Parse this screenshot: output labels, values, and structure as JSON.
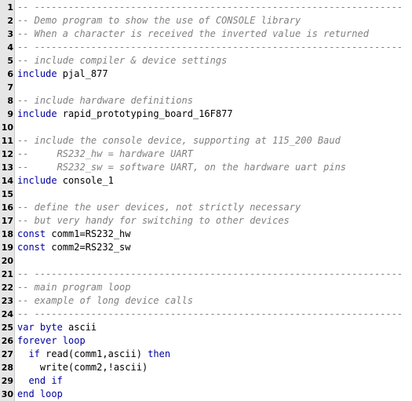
{
  "colors": {
    "comment": "#808080",
    "keyword": "#0000a0",
    "constant": "#008000",
    "text": "#000000",
    "gutter_bg": "#e6e6e6"
  },
  "lines": [
    {
      "n": "1",
      "tokens": [
        {
          "t": "-- -----------------------------------------------------------------",
          "k": "comment"
        }
      ]
    },
    {
      "n": "2",
      "tokens": [
        {
          "t": "-- Demo program to show the use of CONSOLE library",
          "k": "comment"
        }
      ]
    },
    {
      "n": "3",
      "tokens": [
        {
          "t": "-- When a character is received the inverted value is returned",
          "k": "comment"
        }
      ]
    },
    {
      "n": "4",
      "tokens": [
        {
          "t": "-- -----------------------------------------------------------------",
          "k": "comment"
        }
      ]
    },
    {
      "n": "5",
      "tokens": [
        {
          "t": "-- include compiler & device settings",
          "k": "comment"
        }
      ]
    },
    {
      "n": "6",
      "tokens": [
        {
          "t": "include",
          "k": "keyword"
        },
        {
          "t": " pjal_877",
          "k": "plain"
        }
      ]
    },
    {
      "n": "7",
      "tokens": []
    },
    {
      "n": "8",
      "tokens": [
        {
          "t": "-- include hardware definitions",
          "k": "comment"
        }
      ]
    },
    {
      "n": "9",
      "tokens": [
        {
          "t": "include",
          "k": "keyword"
        },
        {
          "t": " rapid_prototyping_board_16F877",
          "k": "plain"
        }
      ]
    },
    {
      "n": "10",
      "tokens": []
    },
    {
      "n": "11",
      "tokens": [
        {
          "t": "-- include the console device, supporting at 115_200 Baud",
          "k": "comment"
        }
      ]
    },
    {
      "n": "12",
      "tokens": [
        {
          "t": "--     RS232_hw = hardware UART",
          "k": "comment"
        }
      ]
    },
    {
      "n": "13",
      "tokens": [
        {
          "t": "--     RS232_sw = software UART, on the hardware uart pins",
          "k": "comment"
        }
      ]
    },
    {
      "n": "14",
      "tokens": [
        {
          "t": "include",
          "k": "keyword"
        },
        {
          "t": " console_1",
          "k": "plain"
        }
      ]
    },
    {
      "n": "15",
      "tokens": []
    },
    {
      "n": "16",
      "tokens": [
        {
          "t": "-- define the user devices, not strictly necessary",
          "k": "comment"
        }
      ]
    },
    {
      "n": "17",
      "tokens": [
        {
          "t": "-- but very handy for switching to other devices",
          "k": "comment"
        }
      ]
    },
    {
      "n": "18",
      "tokens": [
        {
          "t": "const",
          "k": "keyword"
        },
        {
          "t": " comm1=",
          "k": "plain"
        },
        {
          "t": "RS232_hw",
          "k": "constant"
        }
      ]
    },
    {
      "n": "19",
      "tokens": [
        {
          "t": "const",
          "k": "keyword"
        },
        {
          "t": " comm2=",
          "k": "plain"
        },
        {
          "t": "RS232_sw",
          "k": "constant"
        }
      ]
    },
    {
      "n": "20",
      "tokens": []
    },
    {
      "n": "21",
      "tokens": [
        {
          "t": "-- -----------------------------------------------------------------",
          "k": "comment"
        }
      ]
    },
    {
      "n": "22",
      "tokens": [
        {
          "t": "-- main program loop",
          "k": "comment"
        }
      ]
    },
    {
      "n": "23",
      "tokens": [
        {
          "t": "-- example of long device calls",
          "k": "comment"
        }
      ]
    },
    {
      "n": "24",
      "tokens": [
        {
          "t": "-- -----------------------------------------------------------------",
          "k": "comment"
        }
      ]
    },
    {
      "n": "25",
      "tokens": [
        {
          "t": "var byte",
          "k": "keyword"
        },
        {
          "t": " ascii",
          "k": "plain"
        }
      ]
    },
    {
      "n": "26",
      "tokens": [
        {
          "t": "forever loop",
          "k": "keyword"
        }
      ]
    },
    {
      "n": "27",
      "tokens": [
        {
          "t": "  ",
          "k": "plain"
        },
        {
          "t": "if",
          "k": "keyword"
        },
        {
          "t": " read(comm1,ascii) ",
          "k": "plain"
        },
        {
          "t": "then",
          "k": "keyword"
        }
      ]
    },
    {
      "n": "28",
      "tokens": [
        {
          "t": "    write(comm2,!ascii)",
          "k": "plain"
        }
      ]
    },
    {
      "n": "29",
      "tokens": [
        {
          "t": "  ",
          "k": "plain"
        },
        {
          "t": "end if",
          "k": "keyword"
        }
      ]
    },
    {
      "n": "30",
      "tokens": [
        {
          "t": "end loop",
          "k": "keyword"
        }
      ]
    }
  ]
}
